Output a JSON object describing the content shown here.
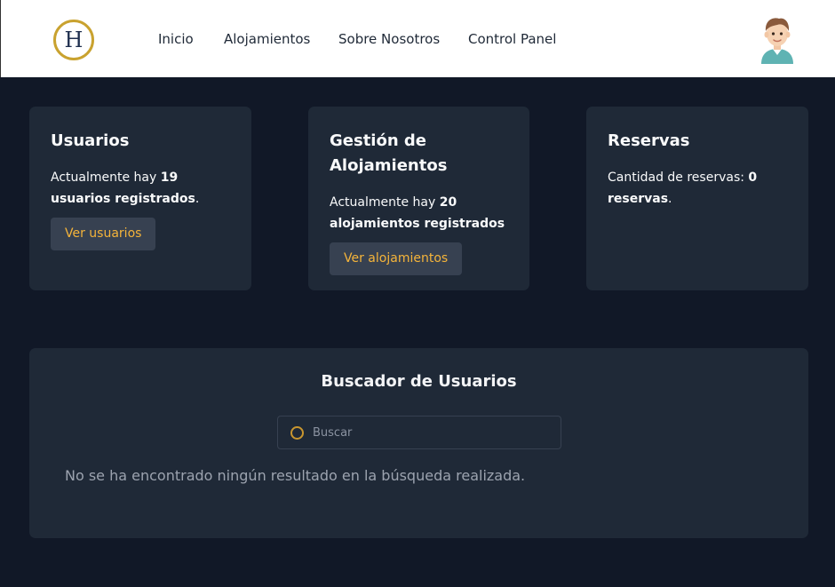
{
  "header": {
    "logo_letter": "H",
    "nav": [
      "Inicio",
      "Alojamientos",
      "Sobre Nosotros",
      "Control Panel"
    ]
  },
  "cards": {
    "users": {
      "title": "Usuarios",
      "text_prefix": "Actualmente hay ",
      "count": "19",
      "text_bold_suffix": "usuarios registrados",
      "text_end": ".",
      "button": "Ver usuarios"
    },
    "lodgings": {
      "title": "Gestión de Alojamientos",
      "text_prefix": "Actualmente hay ",
      "count": "20",
      "text_bold_suffix": "alojamientos registrados",
      "button": "Ver alojamientos"
    },
    "bookings": {
      "title": "Reservas",
      "text_prefix": "Cantidad de reservas: ",
      "count": "0",
      "text_bold_suffix": "reservas",
      "text_end": "."
    }
  },
  "search": {
    "title": "Buscador de Usuarios",
    "placeholder": "Buscar",
    "empty_message": "No se ha encontrado ningún resultado en la búsqueda realizada."
  },
  "colors": {
    "background": "#111827",
    "card": "#1f2937",
    "accent": "#f5b43a",
    "logo_gold": "#c9a22f",
    "logo_navy": "#1f2f4f"
  }
}
